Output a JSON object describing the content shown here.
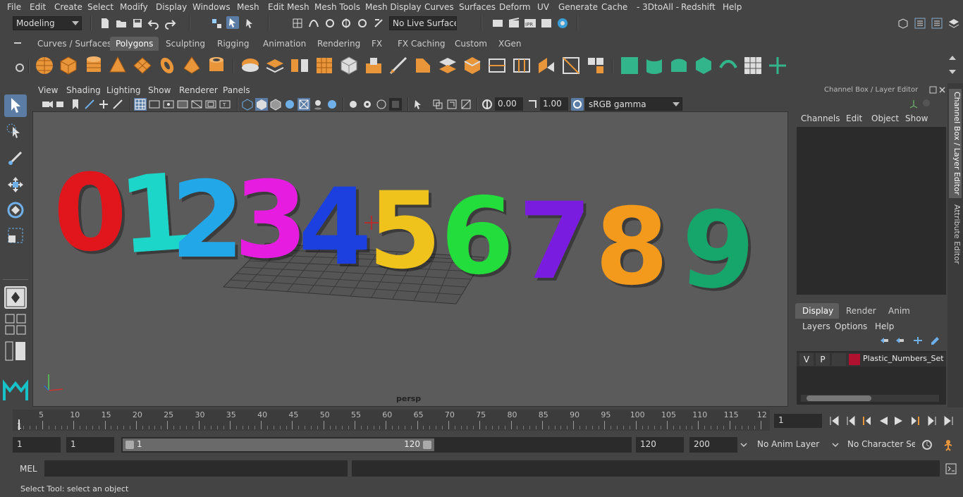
{
  "menubar": {
    "items": [
      "File",
      "Edit",
      "Create",
      "Select",
      "Modify",
      "Display",
      "Windows",
      "Mesh",
      "Edit Mesh",
      "Mesh Tools",
      "Mesh Display",
      "Curves",
      "Surfaces",
      "Deform",
      "UV",
      "Generate",
      "Cache",
      "- 3DtoAll -",
      "Redshift",
      "Help"
    ]
  },
  "statusline": {
    "menuset": "Modeling",
    "live_surface": "No Live Surface"
  },
  "shelf": {
    "tabs": [
      "Curves / Surfaces",
      "Polygons",
      "Sculpting",
      "Rigging",
      "Animation",
      "Rendering",
      "FX",
      "FX Caching",
      "Custom",
      "XGen"
    ],
    "active_tab": "Polygons"
  },
  "viewport": {
    "menu": [
      "View",
      "Shading",
      "Lighting",
      "Show",
      "Renderer",
      "Panels"
    ],
    "near_value": "0.00",
    "far_value": "1.00",
    "color_space": "sRGB gamma",
    "camera_label": "persp",
    "scene_numbers": [
      "0",
      "1",
      "2",
      "3",
      "4",
      "5",
      "6",
      "7",
      "8",
      "9"
    ],
    "number_colors": [
      "#e0161c",
      "#1bd6c9",
      "#22a7e8",
      "#e61ee0",
      "#1a3fe0",
      "#f0c21a",
      "#22dd3a",
      "#7a1fe0",
      "#f39a1e",
      "#12a56b"
    ]
  },
  "channelbox": {
    "title": "Channel Box / Layer Editor",
    "menu": [
      "Channels",
      "Edit",
      "Object",
      "Show"
    ],
    "layer_tabs": [
      "Display",
      "Render",
      "Anim"
    ],
    "active_layer_tab": "Display",
    "layer_menu": [
      "Layers",
      "Options",
      "Help"
    ],
    "layer": {
      "v": "V",
      "p": "P",
      "name": "Plastic_Numbers_Set",
      "color": "#b0112e"
    }
  },
  "sidetabs": [
    "Channel Box / Layer Editor",
    "Attribute Editor"
  ],
  "timeline": {
    "ticks": [
      "5",
      "10",
      "15",
      "20",
      "25",
      "30",
      "35",
      "40",
      "45",
      "50",
      "55",
      "60",
      "65",
      "70",
      "75",
      "80",
      "85",
      "90",
      "95",
      "100",
      "105",
      "110",
      "115",
      "12"
    ],
    "start_marker": "1",
    "current_frame": "1"
  },
  "range": {
    "start": "1",
    "playback_start": "1",
    "slider_start": "1",
    "slider_end": "120",
    "playback_end": "120",
    "end": "200",
    "anim_layer": "No Anim Layer",
    "character_set": "No Character Set"
  },
  "cmdline": {
    "label": "MEL"
  },
  "helpline": {
    "text": "Select Tool: select an object"
  }
}
